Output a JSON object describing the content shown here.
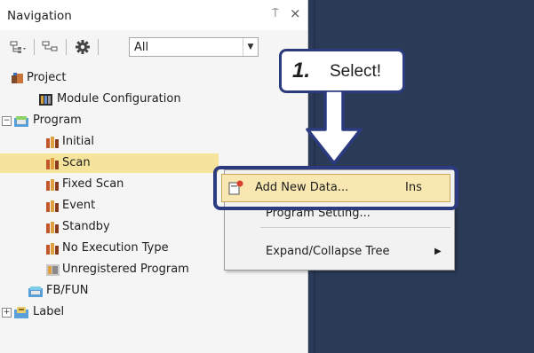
{
  "panel": {
    "title": "Navigation",
    "pin_glyph": "⍑",
    "close_glyph": "×"
  },
  "toolbar": {
    "filter_value": "All",
    "icons": [
      "tree-expand-icon",
      "tree-collapse-icon",
      "gear-icon"
    ]
  },
  "tree": {
    "items": [
      {
        "label": "Project",
        "icon": "project-icon",
        "level": 0,
        "expander": ""
      },
      {
        "label": "Module Configuration",
        "icon": "module-config-icon",
        "level": 1,
        "expander": ""
      },
      {
        "label": "Program",
        "icon": "program-folder-icon",
        "level": 0,
        "expander": "−"
      },
      {
        "label": "Initial",
        "icon": "program-icon",
        "level": 2,
        "expander": ""
      },
      {
        "label": "Scan",
        "icon": "program-icon",
        "level": 2,
        "expander": "",
        "selected": true
      },
      {
        "label": "Fixed Scan",
        "icon": "program-icon",
        "level": 2,
        "expander": ""
      },
      {
        "label": "Event",
        "icon": "program-icon",
        "level": 2,
        "expander": ""
      },
      {
        "label": "Standby",
        "icon": "program-icon",
        "level": 2,
        "expander": ""
      },
      {
        "label": "No Execution Type",
        "icon": "program-icon",
        "level": 2,
        "expander": ""
      },
      {
        "label": "Unregistered Program",
        "icon": "unregistered-program-icon",
        "level": 2,
        "expander": ""
      },
      {
        "label": "FB/FUN",
        "icon": "fb-fun-icon",
        "level": 1,
        "expander": ""
      },
      {
        "label": "Label",
        "icon": "label-icon",
        "level": 0,
        "expander": "+"
      }
    ]
  },
  "context_menu": {
    "items": [
      {
        "label": "Add New Data...",
        "shortcut": "Ins",
        "icon": "add-new-data-icon"
      },
      {
        "label": "Program Setting...",
        "shortcut": ""
      },
      {
        "label": "Expand/Collapse Tree",
        "shortcut": "",
        "submenu_glyph": "▶"
      }
    ]
  },
  "callout": {
    "number": "1.",
    "text": "Select!"
  },
  "colors": {
    "accent": "#2c3a80",
    "selection": "#f7e49c",
    "editor_bg": "#2b3a56"
  }
}
